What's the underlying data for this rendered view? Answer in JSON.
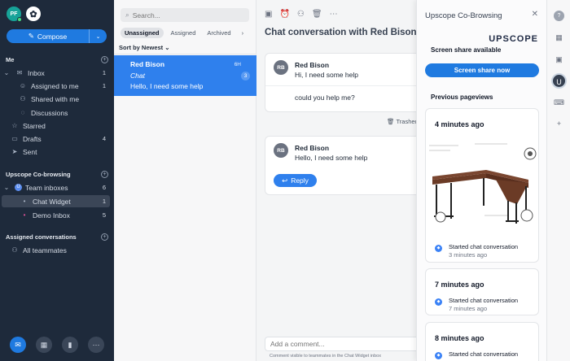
{
  "nav": {
    "avatar_initials": "PF",
    "compose_label": "Compose",
    "me_section": "Me",
    "items": [
      {
        "label": "Inbox",
        "count": "1"
      },
      {
        "label": "Assigned to me",
        "count": "1"
      },
      {
        "label": "Shared with me",
        "count": ""
      },
      {
        "label": "Discussions",
        "count": ""
      },
      {
        "label": "Starred",
        "count": ""
      },
      {
        "label": "Drafts",
        "count": "4"
      },
      {
        "label": "Sent",
        "count": ""
      }
    ],
    "upscope_section": "Upscope Co-browsing",
    "team_inboxes": {
      "label": "Team inboxes",
      "count": "6"
    },
    "chat_widget": {
      "label": "Chat Widget",
      "count": "1"
    },
    "demo_inbox": {
      "label": "Demo Inbox",
      "count": "5"
    },
    "assigned_section": "Assigned conversations",
    "all_teammates": "All teammates"
  },
  "list": {
    "search_placeholder": "Search...",
    "tabs": [
      "Unassigned",
      "Assigned",
      "Archived"
    ],
    "sort_label": "Sort by Newest",
    "conversation": {
      "name": "Red Bison",
      "time": "6H",
      "channel": "Chat",
      "preview": "Hello, I need some help",
      "unread": "3"
    }
  },
  "conversation": {
    "title": "Chat conversation with Red Bison",
    "msg1": {
      "initials": "RB",
      "author": "Red Bison",
      "text": "Hi, I need some help",
      "followup": "could you help me?"
    },
    "trashed": "Trashed",
    "msg2": {
      "initials": "RB",
      "author": "Red Bison",
      "text": "Hello, I need some help"
    },
    "reply_label": "Reply",
    "comment_placeholder": "Add a comment...",
    "comment_note": "Comment visible to teammates in the Chat Widget inbox"
  },
  "upscope": {
    "title": "Upscope Co-Browsing",
    "brand": "UPSCOPE",
    "screen_share_label": "Screen share available",
    "screen_share_button": "Screen share now",
    "previous_label": "Previous pageviews",
    "pageviews": [
      {
        "when": "4 minutes ago",
        "event": "Started chat conversation",
        "event_time": "3 minutes ago"
      },
      {
        "when": "7 minutes ago",
        "event": "Started chat conversation",
        "event_time": "7 minutes ago"
      },
      {
        "when": "8 minutes ago",
        "event": "Started chat conversation",
        "event_time": ""
      }
    ]
  },
  "colors": {
    "nav_bg": "#1e2a3b",
    "accent": "#1f7ae0",
    "selected_conversation": "#2f80ed"
  }
}
